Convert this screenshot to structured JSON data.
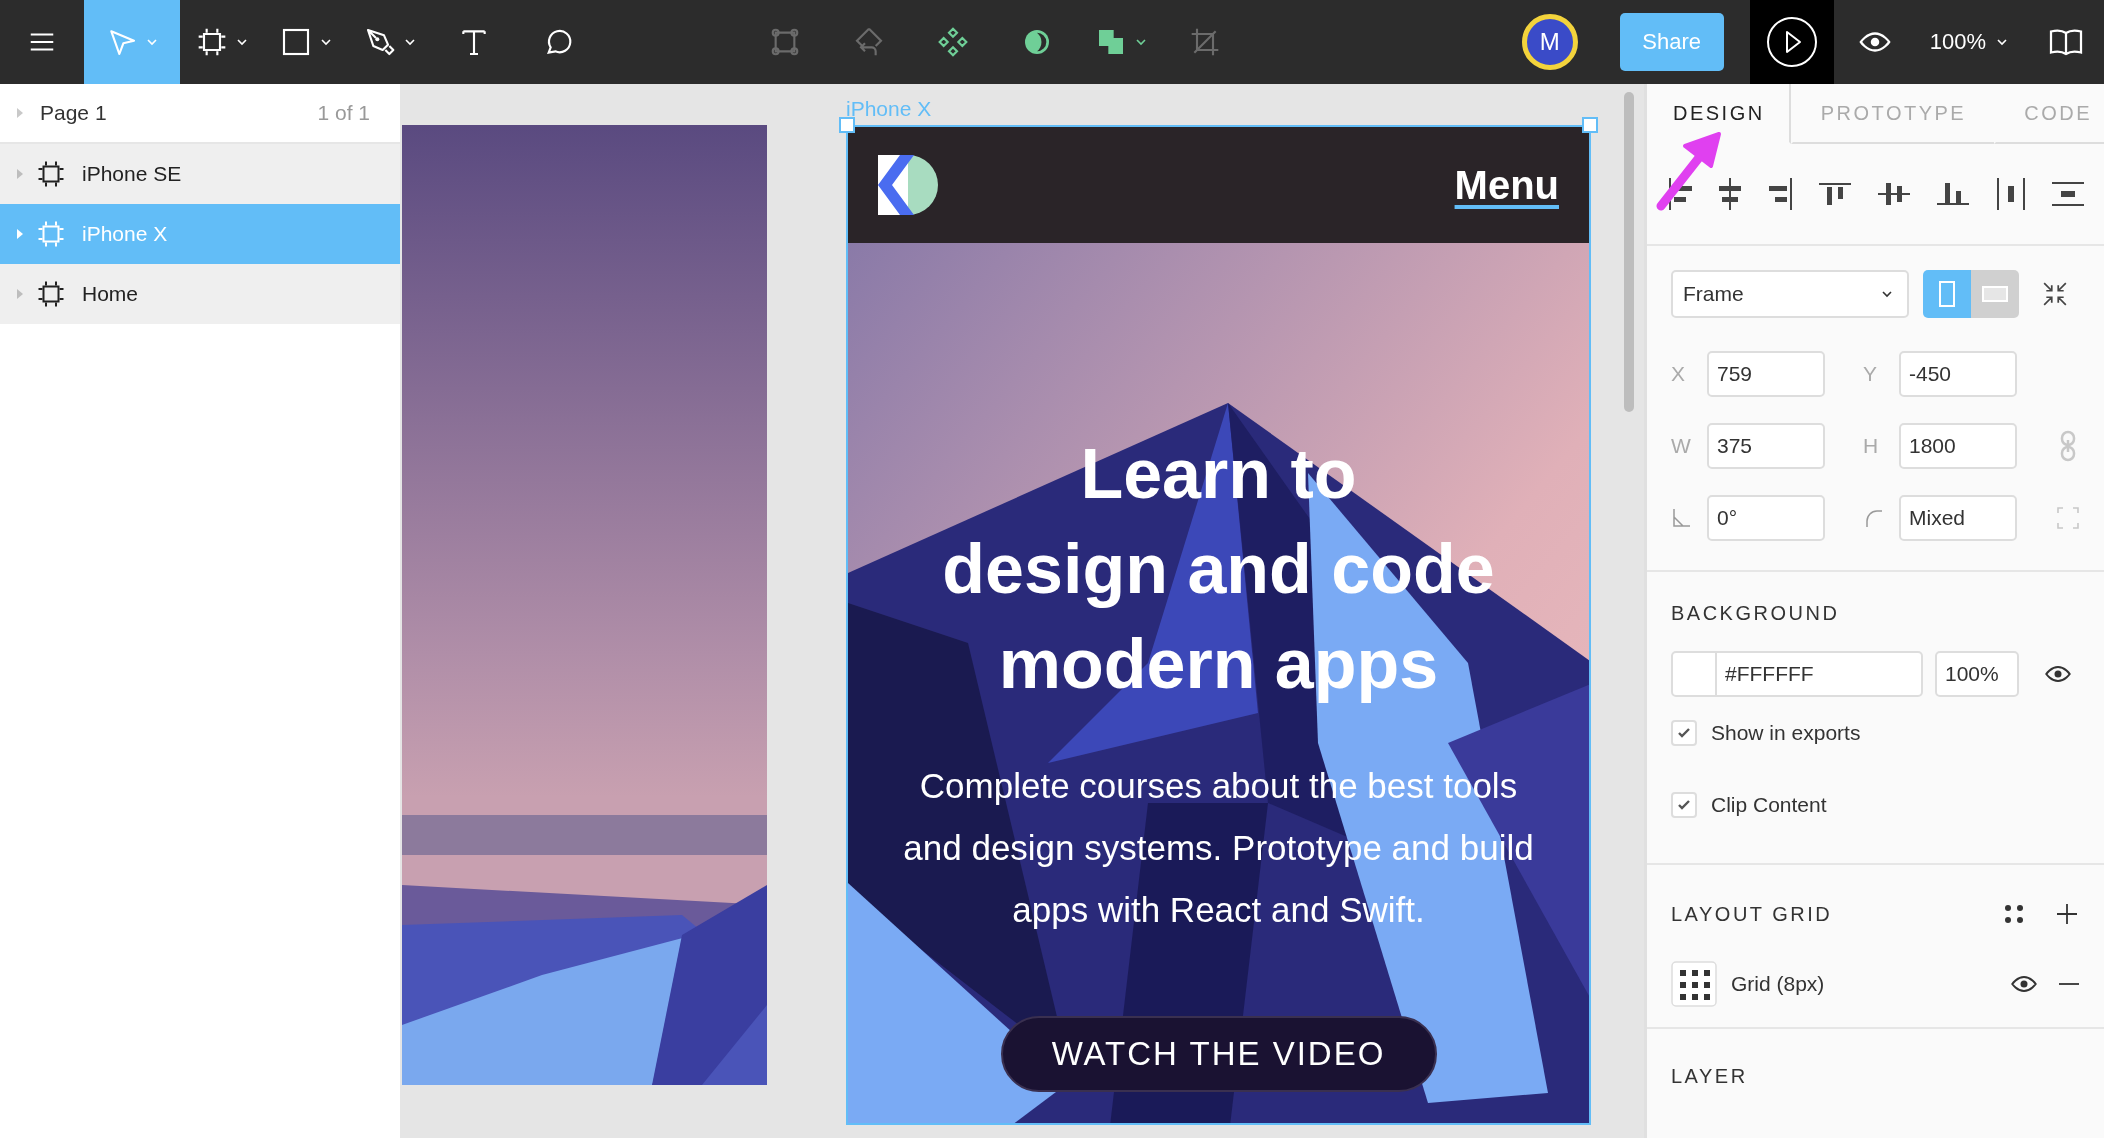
{
  "toolbar": {
    "tools": [
      {
        "kind": "move",
        "selected": true,
        "dropdown": true
      },
      {
        "kind": "frame",
        "selected": false,
        "dropdown": true
      },
      {
        "kind": "rectangle",
        "selected": false,
        "dropdown": true
      },
      {
        "kind": "pen",
        "selected": false,
        "dropdown": true
      },
      {
        "kind": "text",
        "selected": false,
        "dropdown": false
      },
      {
        "kind": "comment",
        "selected": false,
        "dropdown": false
      }
    ],
    "actions": [
      {
        "kind": "frame-selection",
        "disabled": true,
        "dropdown": false
      },
      {
        "kind": "reset",
        "disabled": true,
        "dropdown": false
      },
      {
        "kind": "component",
        "disabled": false,
        "dropdown": false
      },
      {
        "kind": "mask",
        "disabled": false,
        "dropdown": false
      },
      {
        "kind": "union",
        "disabled": false,
        "dropdown": true
      },
      {
        "kind": "crop",
        "disabled": true,
        "dropdown": false
      }
    ],
    "avatar": {
      "initial": "M"
    },
    "share": "Share",
    "zoom": "100%"
  },
  "pages": {
    "name": "Page 1",
    "count": "1 of 1"
  },
  "layers": [
    {
      "name": "iPhone SE",
      "selected": false
    },
    {
      "name": "iPhone X",
      "selected": true
    },
    {
      "name": "Home",
      "selected": false
    }
  ],
  "canvas": {
    "frame_label": "iPhone X",
    "menu": "Menu",
    "title_lines": [
      "Learn to",
      "design and code",
      "modern apps"
    ],
    "subtitle_lines": [
      "Complete courses about the best tools",
      "and design systems. Prototype and build",
      "apps with React and Swift."
    ],
    "cta": "WATCH THE VIDEO"
  },
  "inspector": {
    "tabs": [
      {
        "label": "DESIGN",
        "selected": true
      },
      {
        "label": "PROTOTYPE",
        "selected": false
      },
      {
        "label": "CODE",
        "selected": false
      }
    ],
    "align": [
      {
        "kind": "left"
      },
      {
        "kind": "hcenter"
      },
      {
        "kind": "right"
      },
      {
        "kind": "top"
      },
      {
        "kind": "vcenter"
      },
      {
        "kind": "bottom"
      },
      {
        "kind": "hdistribute"
      },
      {
        "kind": "vdistribute"
      }
    ],
    "preset": "Frame",
    "orientation": [
      {
        "kind": "portrait",
        "selected": true
      },
      {
        "kind": "landscape",
        "selected": false
      }
    ],
    "rows": [
      {
        "kind": "position",
        "fields": [
          {
            "kind": "text",
            "label": "X",
            "value": "759"
          },
          {
            "kind": "text",
            "label": "Y",
            "value": "-450"
          }
        ]
      },
      {
        "kind": "size",
        "fields": [
          {
            "kind": "text",
            "label": "W",
            "value": "375"
          },
          {
            "kind": "text",
            "label": "H",
            "value": "1800"
          }
        ]
      },
      {
        "kind": "corners",
        "fields": [
          {
            "kind": "rotation",
            "value": "0°"
          },
          {
            "kind": "radius",
            "value": "Mixed"
          }
        ]
      }
    ],
    "background": {
      "title": "BACKGROUND",
      "hex": "#FFFFFF",
      "opacity": "100%",
      "options": [
        {
          "label": "Show in exports",
          "checked": true
        },
        {
          "label": "Clip Content",
          "checked": true
        }
      ]
    },
    "layout_grid": {
      "title": "LAYOUT GRID",
      "items": [
        {
          "label": "Grid (8px)"
        }
      ]
    },
    "layer": {
      "title": "LAYER"
    }
  }
}
